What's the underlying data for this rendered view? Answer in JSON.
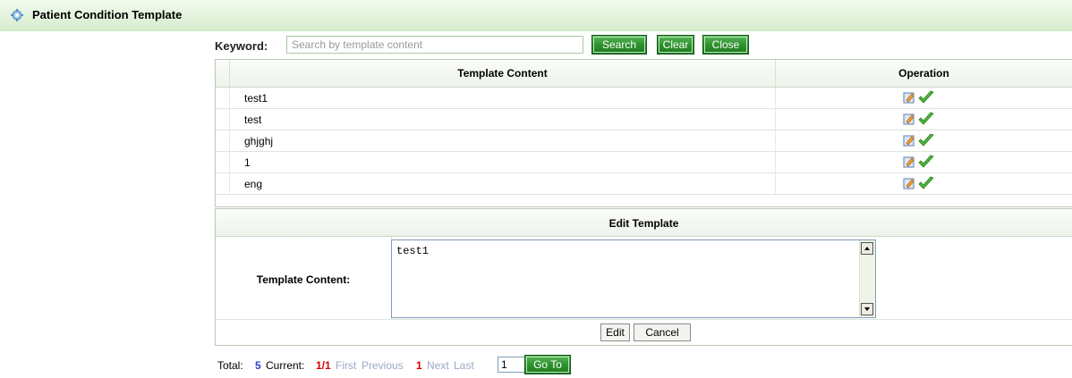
{
  "header": {
    "title": "Patient Condition Template",
    "icon": "gear-icon"
  },
  "search": {
    "label": "Keyword:",
    "placeholder": "Search by template content",
    "value": "",
    "buttons": {
      "search": "Search",
      "clear": "Clear",
      "close": "Close"
    }
  },
  "table": {
    "columns": [
      "Template Content",
      "Operation"
    ],
    "rows": [
      {
        "content": "test1"
      },
      {
        "content": "test"
      },
      {
        "content": "ghjghj"
      },
      {
        "content": "1"
      },
      {
        "content": "eng"
      }
    ],
    "row_icons": [
      "edit-icon",
      "check-icon"
    ]
  },
  "edit_panel": {
    "title": "Edit Template",
    "field_label": "Template Content:",
    "field_value": "test1",
    "buttons": {
      "edit": "Edit",
      "cancel": "Cancel"
    }
  },
  "pager": {
    "total_label": "Total:",
    "total": "5",
    "current_label": "Current:",
    "current": "1/1",
    "first": "First",
    "previous": "Previous",
    "page": "1",
    "next": "Next",
    "last": "Last",
    "goto_value": "1",
    "goto_button": "Go To"
  },
  "colors": {
    "accent_green": "#2f922f",
    "header_bg": "#e3f3dc",
    "link_blue": "#2a3fc8",
    "link_red": "#d40000"
  }
}
